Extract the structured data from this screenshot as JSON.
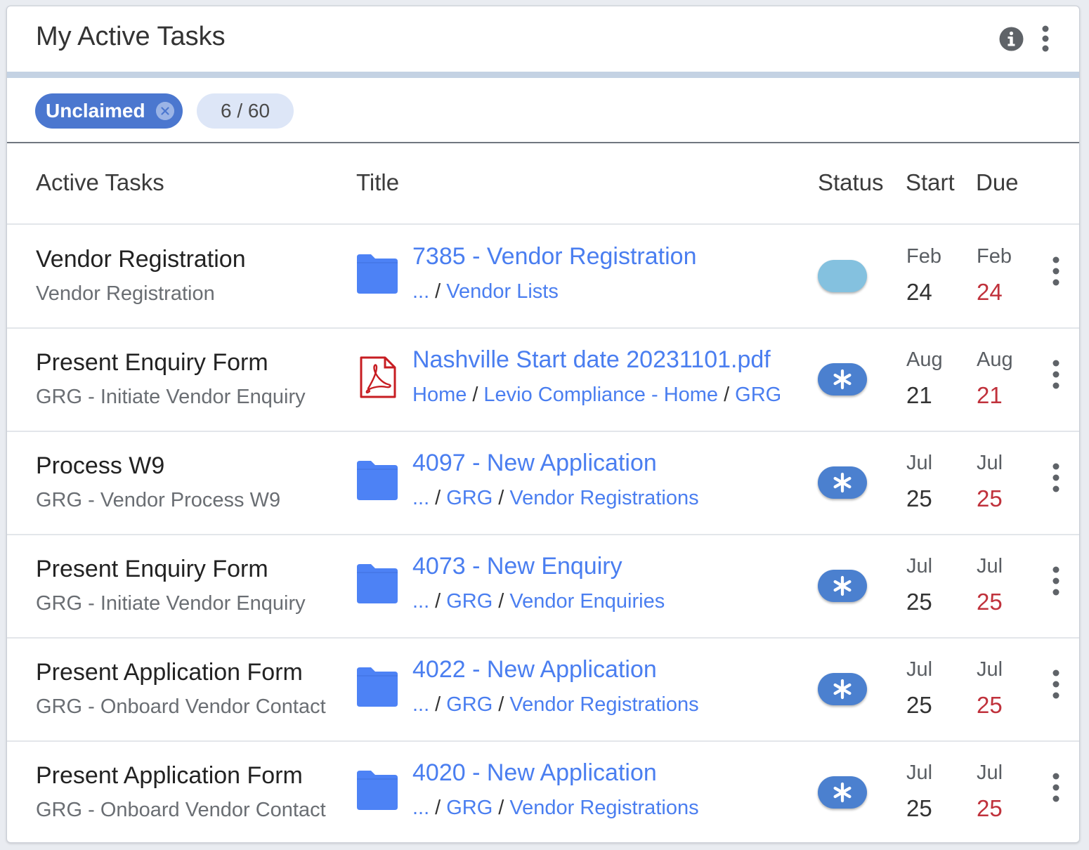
{
  "header": {
    "title": "My Active Tasks"
  },
  "filters": {
    "chip_label": "Unclaimed",
    "count": "6 / 60"
  },
  "columns": {
    "active_tasks": "Active Tasks",
    "title": "Title",
    "status": "Status",
    "start": "Start",
    "due": "Due"
  },
  "colors": {
    "accent": "#4a7ef0",
    "due_red": "#c0323c",
    "chip_blue": "#4b77cf",
    "status_light": "#84c1df",
    "status_dark": "#4b80cf"
  },
  "rows": [
    {
      "task": "Vendor Registration",
      "subtask": "Vendor Registration",
      "icon": "folder-icon",
      "title": "7385 - Vendor Registration",
      "path": [
        "...",
        "Vendor Lists"
      ],
      "status": "light",
      "start_month": "Feb",
      "start_day": "24",
      "due_month": "Feb",
      "due_day": "24"
    },
    {
      "task": "Present Enquiry Form",
      "subtask": "GRG - Initiate Vendor Enquiry",
      "icon": "pdf-icon",
      "title": "Nashville Start date 20231101.pdf",
      "path": [
        "Home",
        "Levio Compliance - Home",
        "GRG"
      ],
      "status": "asterisk",
      "start_month": "Aug",
      "start_day": "21",
      "due_month": "Aug",
      "due_day": "21"
    },
    {
      "task": "Process W9",
      "subtask": "GRG - Vendor Process W9",
      "icon": "folder-icon",
      "title": "4097 - New Application",
      "path": [
        "...",
        "GRG",
        "Vendor Registrations"
      ],
      "status": "asterisk",
      "start_month": "Jul",
      "start_day": "25",
      "due_month": "Jul",
      "due_day": "25"
    },
    {
      "task": "Present Enquiry Form",
      "subtask": "GRG - Initiate Vendor Enquiry",
      "icon": "folder-icon",
      "title": "4073 - New Enquiry",
      "path": [
        "...",
        "GRG",
        "Vendor Enquiries"
      ],
      "status": "asterisk",
      "start_month": "Jul",
      "start_day": "25",
      "due_month": "Jul",
      "due_day": "25"
    },
    {
      "task": "Present Application Form",
      "subtask": "GRG - Onboard Vendor Contact",
      "icon": "folder-icon",
      "title": "4022 - New Application",
      "path": [
        "...",
        "GRG",
        "Vendor Registrations"
      ],
      "status": "asterisk",
      "start_month": "Jul",
      "start_day": "25",
      "due_month": "Jul",
      "due_day": "25"
    },
    {
      "task": "Present Application Form",
      "subtask": "GRG - Onboard Vendor Contact",
      "icon": "folder-icon",
      "title": "4020 - New Application",
      "path": [
        "...",
        "GRG",
        "Vendor Registrations"
      ],
      "status": "asterisk",
      "start_month": "Jul",
      "start_day": "25",
      "due_month": "Jul",
      "due_day": "25"
    }
  ]
}
